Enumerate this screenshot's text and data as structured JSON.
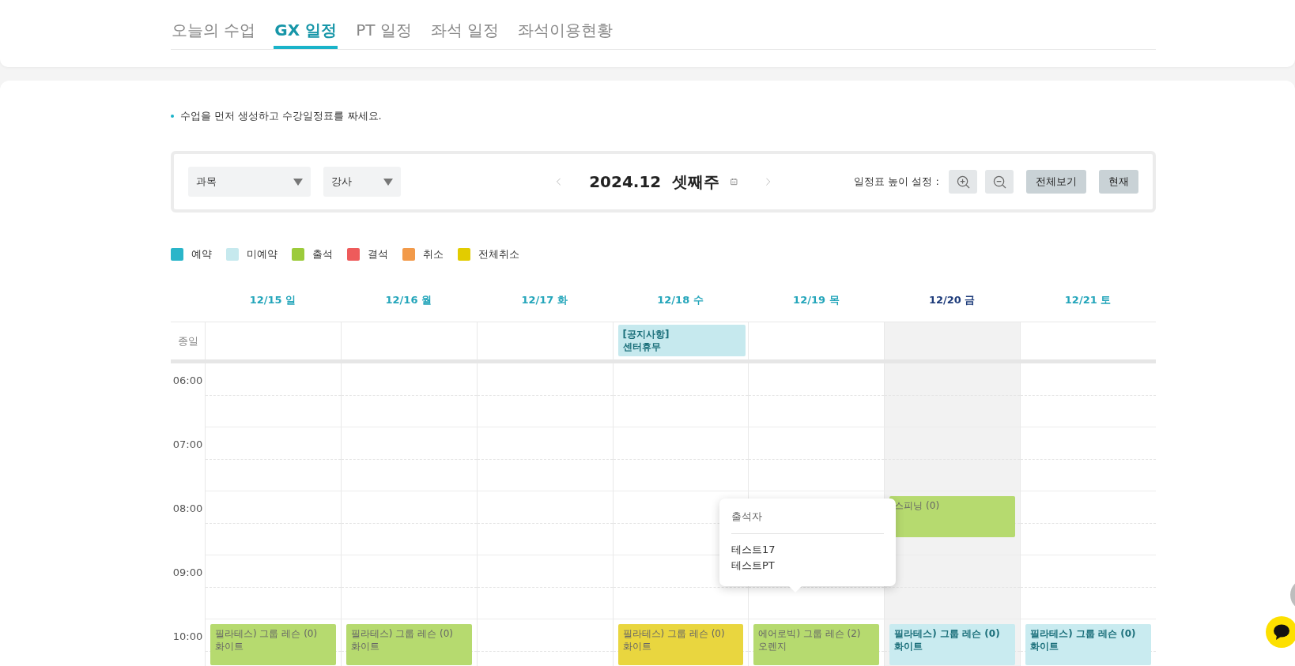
{
  "tabs": [
    {
      "label": "오늘의 수업",
      "selected": false
    },
    {
      "label": "GX 일정",
      "selected": true
    },
    {
      "label": "PT 일정",
      "selected": false
    },
    {
      "label": "좌석 일정",
      "selected": false
    },
    {
      "label": "좌석이용현황",
      "selected": false
    }
  ],
  "notice": "수업을 먼저 생성하고 수강일정표를 짜세요.",
  "toolbar": {
    "filters": [
      {
        "label": "과목"
      },
      {
        "label": "강사"
      }
    ],
    "period": "2024.12  셋째주",
    "height_label": "일정표 높이 설정 :",
    "buttons": [
      "전체보기",
      "현재"
    ]
  },
  "legend": [
    {
      "label": "예약",
      "color": "#2ab5c9"
    },
    {
      "label": "미예약",
      "color": "#c6e9ee"
    },
    {
      "label": "출석",
      "color": "#9ccb3b"
    },
    {
      "label": "결석",
      "color": "#ee5b5b"
    },
    {
      "label": "취소",
      "color": "#f29a4a"
    },
    {
      "label": "전체취소",
      "color": "#e2cc00"
    }
  ],
  "schedule": {
    "days": [
      {
        "label": "12/15 일",
        "today": false
      },
      {
        "label": "12/16 월",
        "today": false
      },
      {
        "label": "12/17 화",
        "today": false
      },
      {
        "label": "12/18 수",
        "today": false,
        "allday": [
          {
            "title": "[공지사항]",
            "subtitle": "센터휴무",
            "color": "#c6e9ee"
          }
        ]
      },
      {
        "label": "12/19 목",
        "today": false
      },
      {
        "label": "12/20 금",
        "today": true
      },
      {
        "label": "12/21 토",
        "today": false
      }
    ],
    "allday_label": "종일",
    "rows": [
      {
        "time": "06:00",
        "cells": [
          [],
          [],
          [],
          [],
          [],
          [],
          []
        ]
      },
      {
        "time": "07:00",
        "cells": [
          [],
          [],
          [],
          [],
          [],
          [],
          []
        ]
      },
      {
        "time": "08:00",
        "cells": [
          [],
          [],
          [],
          [],
          [],
          [
            {
              "title": "스피닝 (0)",
              "color": "#b6da6f"
            }
          ],
          []
        ]
      },
      {
        "time": "09:00",
        "cells": [
          [],
          [],
          [],
          [],
          [],
          [],
          []
        ]
      },
      {
        "time": "10:00",
        "cells": [
          [
            {
              "title": "필라테스) 그룹 레슨 (0)",
              "subtitle": "화이트",
              "color": "#b6da6f"
            }
          ],
          [
            {
              "title": "필라테스) 그룹 레슨 (0)",
              "subtitle": "화이트",
              "color": "#b6da6f"
            }
          ],
          [],
          [
            {
              "title": "필라테스) 그룹 레슨 (0)",
              "subtitle": "화이트",
              "color": "#e9d63f"
            }
          ],
          [
            {
              "title": "에어로빅) 그룹 레슨 (2)",
              "subtitle": "오렌지",
              "color": "#b6da6f"
            }
          ],
          [
            {
              "title": "필라테스) 그룹 레슨 (0)",
              "subtitle": "화이트",
              "color": "#c9ebf0"
            }
          ],
          [
            {
              "title": "필라테스) 그룹 레슨 (0)",
              "subtitle": "화이트",
              "color": "#c9ebf0"
            }
          ]
        ]
      }
    ],
    "tooltip": {
      "title": "출석자",
      "names": [
        "테스트17",
        "테스트PT"
      ]
    }
  }
}
